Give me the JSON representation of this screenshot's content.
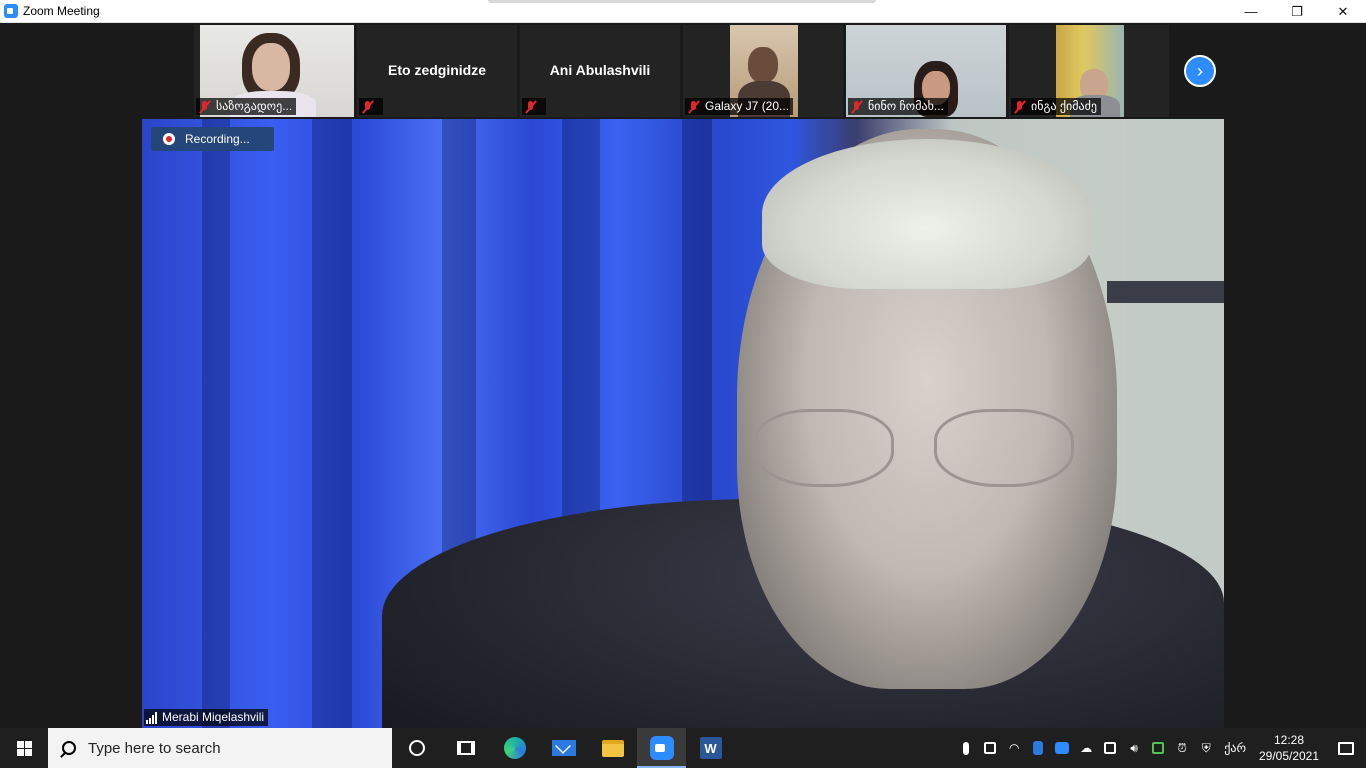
{
  "window": {
    "title": "Zoom Meeting",
    "controls": {
      "minimize": "—",
      "restore": "❐",
      "close": "✕"
    }
  },
  "gallery": {
    "tiles": [
      {
        "label": "საზოგადოე...",
        "has_video": true,
        "muted": true
      },
      {
        "center_name": "Eto zedginidze",
        "has_video": false,
        "muted": true
      },
      {
        "center_name": "Ani Abulashvili",
        "has_video": false,
        "muted": true
      },
      {
        "label": "Galaxy J7 (20...",
        "has_video": true,
        "muted": true
      },
      {
        "label": "ნინო ჩომახ...",
        "has_video": true,
        "muted": true
      },
      {
        "label": "ინგა ქიმაძე",
        "has_video": true,
        "muted": true
      }
    ],
    "next_icon": "chevron-right-icon"
  },
  "main_video": {
    "recording_label": "Recording...",
    "speaker_name": "Merabi Miqelashvili"
  },
  "taskbar": {
    "search_placeholder": "Type here to search",
    "apps": [
      "cortana",
      "task-view",
      "edge",
      "mail",
      "file-explorer",
      "zoom",
      "word"
    ],
    "active_app": "zoom",
    "word_letter": "W",
    "language": "ქარ",
    "time": "12:28",
    "date": "29/05/2021"
  },
  "colors": {
    "zoom_blue": "#2d8cff",
    "mute_red": "#e0262b",
    "recording_badge": "#24467a",
    "taskbar": "#1f1f1f"
  }
}
